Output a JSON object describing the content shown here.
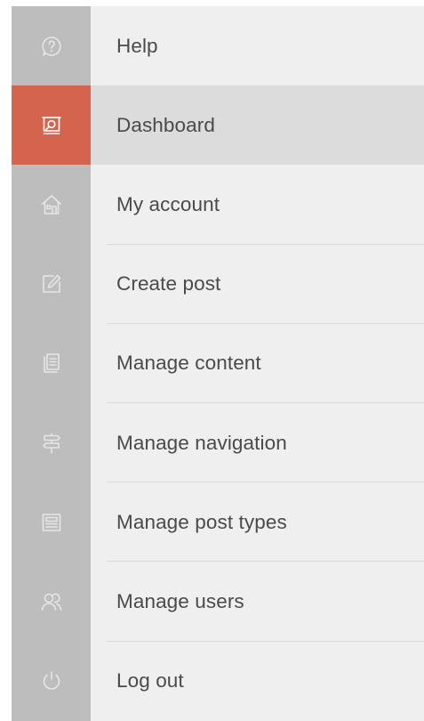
{
  "colors": {
    "rail": "#bdbdbd",
    "menu_bg": "#efefef",
    "active_bg": "#dcdcdc",
    "active_accent": "#d4644e",
    "text": "#4a4a4a"
  },
  "menu": {
    "items": [
      {
        "label": "Help",
        "icon": "help-circle-icon"
      },
      {
        "label": "Dashboard",
        "icon": "dashboard-icon",
        "active": true
      },
      {
        "label": "My account",
        "icon": "home-icon"
      },
      {
        "label": "Create post",
        "icon": "edit-icon"
      },
      {
        "label": "Manage content",
        "icon": "document-list-icon"
      },
      {
        "label": "Manage navigation",
        "icon": "signpost-icon"
      },
      {
        "label": "Manage post types",
        "icon": "post-types-icon"
      },
      {
        "label": "Manage users",
        "icon": "users-icon"
      },
      {
        "label": "Log out",
        "icon": "power-icon"
      }
    ]
  }
}
